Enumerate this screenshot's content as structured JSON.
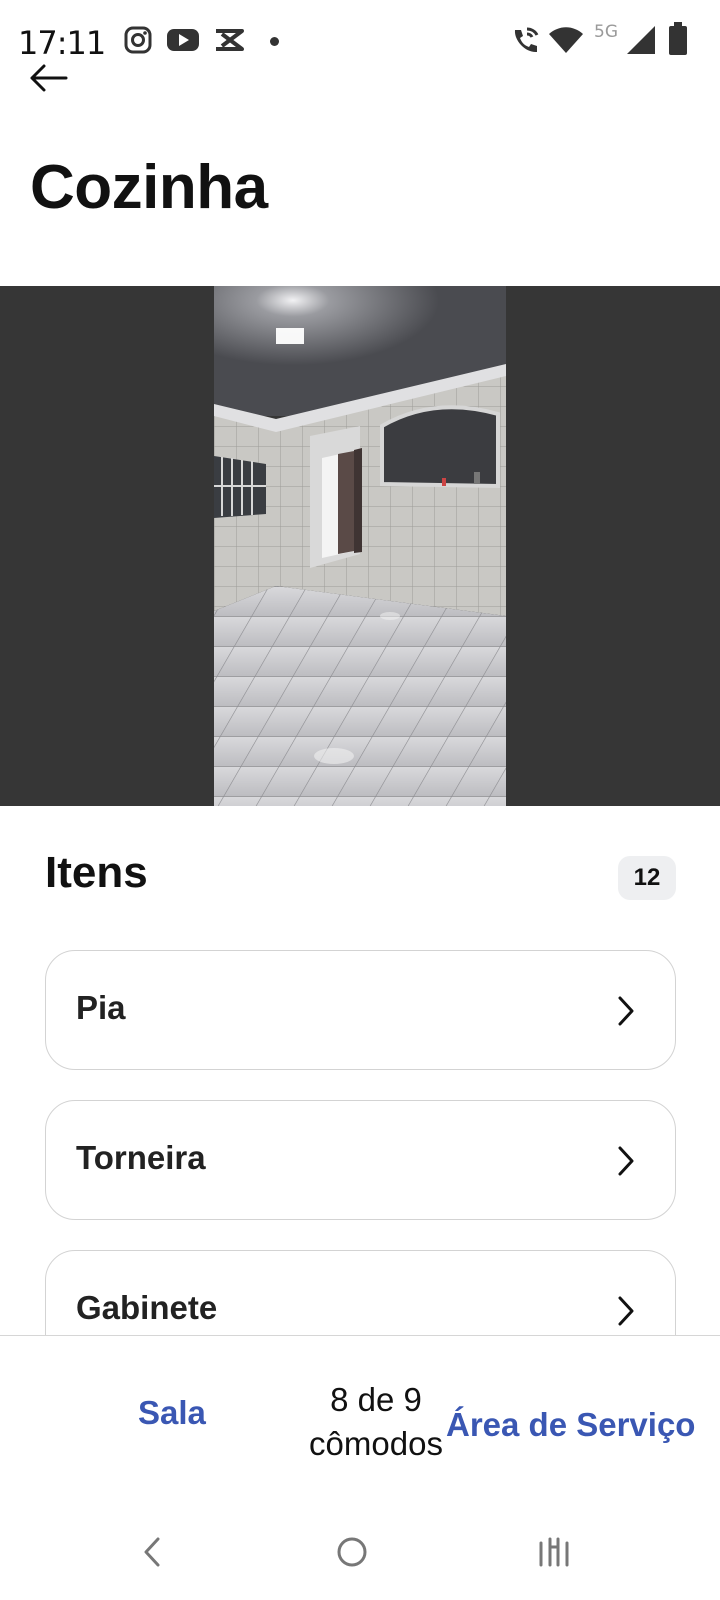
{
  "status_bar": {
    "time": "17:11",
    "network": "5G",
    "icons": [
      "instagram-icon",
      "youtube-icon",
      "capcut-icon",
      "notification-dot",
      "wifi-call-icon",
      "wifi-icon",
      "signal-icon",
      "battery-icon"
    ]
  },
  "header": {
    "back_icon": "arrow-left-icon",
    "title": "Cozinha"
  },
  "photo": {
    "subject": "kitchen-room-photo"
  },
  "items_section": {
    "title": "Itens",
    "count": "12",
    "items": [
      {
        "label": "Pia"
      },
      {
        "label": "Torneira"
      },
      {
        "label": "Gabinete"
      }
    ]
  },
  "footer": {
    "prev_label": "Sala",
    "progress_line1": "8 de 9",
    "progress_line2": "cômodos",
    "next_label": "Área de Serviço"
  },
  "colors": {
    "accent": "#3a57b3",
    "photo_background": "#363636",
    "badge_background": "#eeeff1",
    "card_border": "#d3d3d3"
  },
  "nav_bar": {
    "back_icon": "nav-back-icon",
    "home_icon": "nav-home-icon",
    "recents_icon": "nav-recents-icon"
  }
}
